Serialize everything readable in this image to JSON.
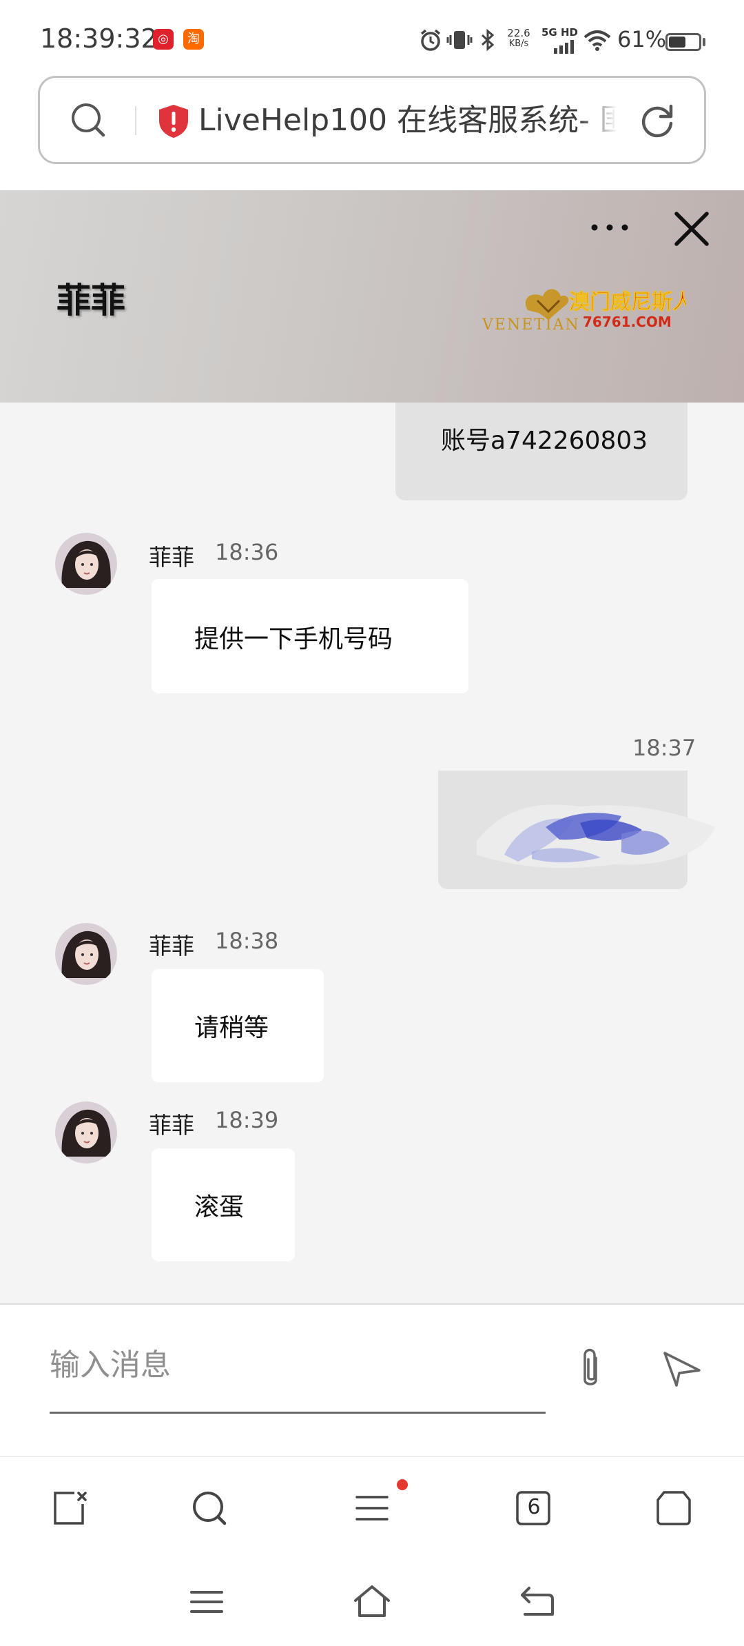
{
  "status_bar": {
    "time": "18:39:32",
    "network_speed_value": "22.6",
    "network_speed_unit": "KB/s",
    "network_type": "5G HD",
    "battery_text": "61%",
    "battery_level_percent": 61,
    "notification_icons": [
      "netease-music-icon",
      "taobao-icon"
    ],
    "notification_icon_glyphs": [
      "◎",
      "淘"
    ],
    "system_icons": [
      "alarm-icon",
      "vibrate-icon",
      "bluetooth-icon",
      "signal-icon",
      "wifi-icon",
      "battery-icon"
    ]
  },
  "address_bar": {
    "page_title": "LiveHelp100 在线客服系统- 匪",
    "security_icon": "warning-shield-icon"
  },
  "chat": {
    "agent_name": "菲菲",
    "header_icons": [
      "more-icon",
      "close-icon"
    ],
    "brand_logo_text_cn": "澳门威尼斯人",
    "brand_logo_text_en": "VENETIAN",
    "brand_logo_url_text": "76761.COM",
    "messages": [
      {
        "direction": "outgoing",
        "text": "账号a742260803"
      },
      {
        "direction": "incoming",
        "sender": "菲菲",
        "time": "18:36",
        "text": "提供一下手机号码"
      },
      {
        "direction": "outgoing",
        "time": "18:37",
        "type": "image"
      },
      {
        "direction": "incoming",
        "sender": "菲菲",
        "time": "18:38",
        "text": "请稍等"
      },
      {
        "direction": "incoming",
        "sender": "菲菲",
        "time": "18:39",
        "text": "滚蛋"
      }
    ]
  },
  "composer": {
    "placeholder": "输入消息",
    "value": "",
    "icons": [
      "attachment-icon",
      "send-icon"
    ]
  },
  "browser_toolbar": {
    "tab_count": "6",
    "has_menu_notification": true,
    "icons": [
      "close-tab-icon",
      "search-icon",
      "menu-icon",
      "tabs-icon",
      "home-icon"
    ]
  },
  "system_nav": {
    "icons": [
      "recents-icon",
      "home-icon",
      "back-icon"
    ]
  },
  "colors": {
    "background": "#f4f4f4",
    "incoming_bubble": "#ffffff",
    "outgoing_bubble": "#e2e2e2",
    "notification_dot": "#e5382e",
    "security_warning": "#e0343c"
  }
}
